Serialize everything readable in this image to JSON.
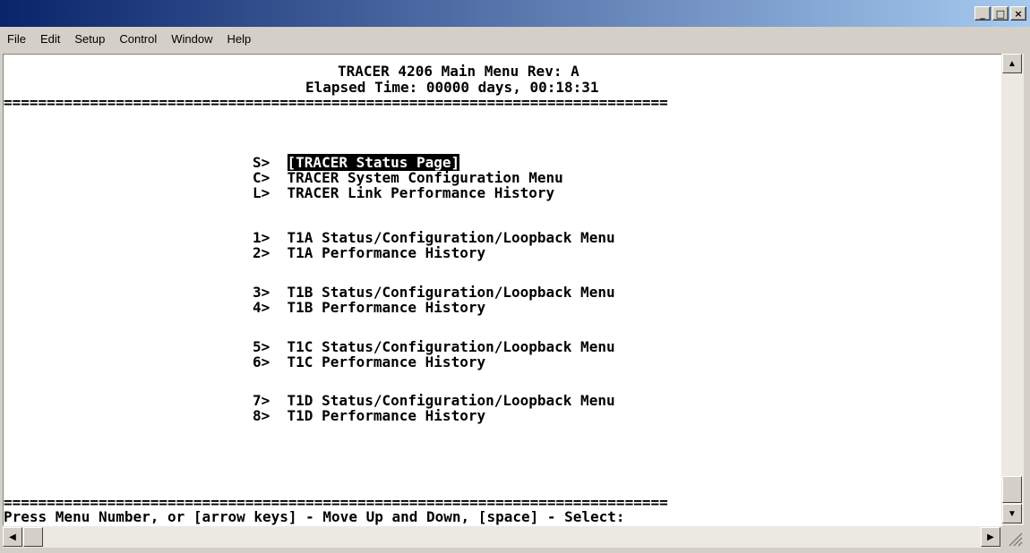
{
  "window": {
    "title": "",
    "controls": {
      "minimize": "_",
      "maximize": "□",
      "close": "×"
    }
  },
  "menu": [
    "File",
    "Edit",
    "Setup",
    "Control",
    "Window",
    "Help"
  ],
  "terminal": {
    "header_title": "TRACER 4206 Main Menu Rev: A",
    "elapsed_label": "Elapsed Time: ",
    "elapsed_value": "00000 days, 00:18:31",
    "separator": "=============================================================================",
    "items": [
      {
        "key": "S>",
        "label": "[TRACER Status Page]",
        "selected": true
      },
      {
        "key": "C>",
        "label": " TRACER System Configuration Menu"
      },
      {
        "key": "L>",
        "label": " TRACER Link Performance History"
      },
      {
        "key": "1>",
        "label": " T1A Status/Configuration/Loopback Menu"
      },
      {
        "key": "2>",
        "label": " T1A Performance History"
      },
      {
        "key": "3>",
        "label": " T1B Status/Configuration/Loopback Menu"
      },
      {
        "key": "4>",
        "label": " T1B Performance History"
      },
      {
        "key": "5>",
        "label": " T1C Status/Configuration/Loopback Menu"
      },
      {
        "key": "6>",
        "label": " T1C Performance History"
      },
      {
        "key": "7>",
        "label": " T1D Status/Configuration/Loopback Menu"
      },
      {
        "key": "8>",
        "label": " T1D Performance History"
      }
    ],
    "prompt": "Press Menu Number, or [arrow keys] - Move Up and Down, [space] - Select:"
  }
}
